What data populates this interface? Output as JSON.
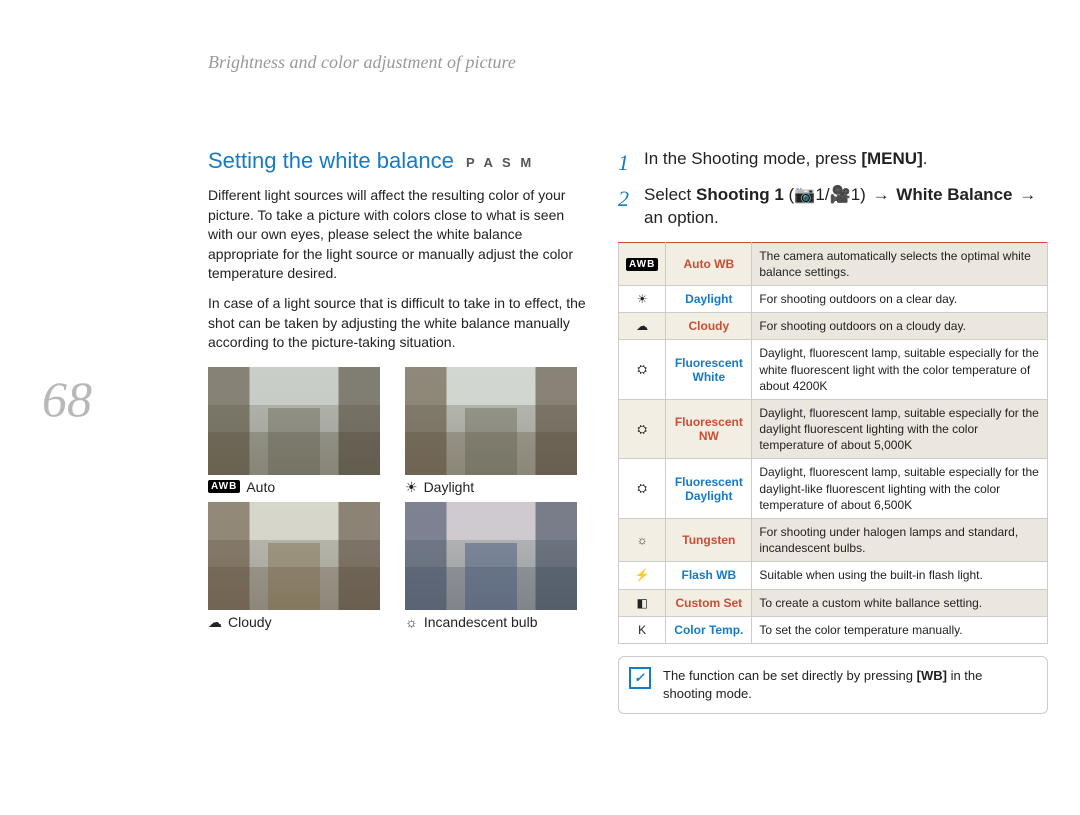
{
  "page_number": "68",
  "breadcrumb": "Brightness and color adjustment of picture",
  "section": {
    "title": "Setting the white balance",
    "mode_badges": "P A S M ",
    "paragraphs": [
      "Different light sources will affect the resulting color of your picture. To take a picture with colors close to what is seen with our own eyes, please select the white balance appropriate for the light source or manually adjust the color temperature desired.",
      "In case of a light source that is difficult to take in to effect, the shot can be taken by adjusting the white balance manually according to the picture-taking situation."
    ],
    "thumbs": [
      {
        "key": "auto",
        "icon_text": "AWB",
        "label": "Auto"
      },
      {
        "key": "daylight",
        "icon_glyph": "☀",
        "label": "Daylight"
      },
      {
        "key": "cloudy",
        "icon_glyph": "☁",
        "label": "Cloudy"
      },
      {
        "key": "incandescent",
        "icon_glyph": "☼",
        "label": "Incandescent bulb"
      }
    ]
  },
  "steps": {
    "step1": {
      "num": "1",
      "text_before": "In the Shooting mode, press ",
      "bold": "[MENU]",
      "text_after": "."
    },
    "step2": {
      "num": "2",
      "text_before": "Select ",
      "bold1": "Shooting 1",
      "paren_open": " (",
      "icons_text": "📷1/🎥1",
      "paren_close": ") ",
      "arrow1": "→",
      "bold2": " White Balance ",
      "arrow2": "→",
      "text_after": " an option."
    }
  },
  "table": {
    "rows": [
      {
        "icon_text": "AWB",
        "name": "Auto WB",
        "name_color": "auto",
        "desc": "The camera automatically selects the optimal white balance settings."
      },
      {
        "icon_glyph": "☀",
        "name": "Daylight",
        "name_color": "blue",
        "desc": "For shooting outdoors on a clear day."
      },
      {
        "icon_glyph": "☁",
        "name": "Cloudy",
        "name_color": "red",
        "desc": "For shooting outdoors on a cloudy day."
      },
      {
        "icon_glyph": "⛭",
        "name": "Fluorescent White",
        "name_color": "blue",
        "desc": "Daylight, fluorescent lamp, suitable especially for the white fluorescent light with the color temperature of about 4200K"
      },
      {
        "icon_glyph": "⛭",
        "name": "Fluorescent NW",
        "name_color": "red",
        "desc": "Daylight, fluorescent lamp, suitable especially for the daylight fluorescent lighting with the color temperature of about 5,000K"
      },
      {
        "icon_glyph": "⛭",
        "name": "Fluorescent Daylight",
        "name_color": "blue",
        "desc": "Daylight, fluorescent lamp, suitable especially for the daylight-like fluorescent lighting with the color temperature of about 6,500K"
      },
      {
        "icon_glyph": "☼",
        "name": "Tungsten",
        "name_color": "red",
        "desc": "For shooting under halogen lamps and standard, incandescent bulbs."
      },
      {
        "icon_glyph": "⚡",
        "name": "Flash WB",
        "name_color": "blue",
        "desc": "Suitable when using the built-in flash light."
      },
      {
        "icon_glyph": "◧",
        "name": "Custom Set",
        "name_color": "red",
        "desc": "To create a custom white ballance setting."
      },
      {
        "icon_glyph": "K",
        "name": "Color Temp.",
        "name_color": "blue",
        "desc": "To set the color temperature manually."
      }
    ]
  },
  "note": {
    "text_before": "The function can be set directly by pressing ",
    "bold": "[WB]",
    "text_after": " in the shooting mode."
  }
}
